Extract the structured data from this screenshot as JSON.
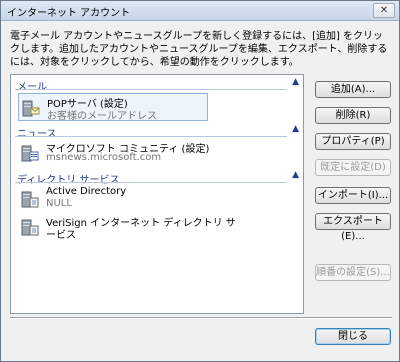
{
  "window": {
    "title": "インターネット アカウント",
    "close_glyph": "✕"
  },
  "description": "電子メール アカウントやニュースグループを新しく登録するには、[追加] をクリックします。追加したアカウントやニュースグループを編集、エクスポート、削除するには、対象をクリックしてから、希望の動作をクリックします。",
  "groups": [
    {
      "title": "メール",
      "items": [
        {
          "name": "POPサーバ (設定)",
          "sub": "お客様のメールアドレス",
          "icon": "mail-server-icon",
          "selected": true
        }
      ]
    },
    {
      "title": "ニュース",
      "items": [
        {
          "name": "マイクロソフト コミュニティ (設定)",
          "sub": "msnews.microsoft.com",
          "icon": "news-server-icon",
          "selected": false
        }
      ]
    },
    {
      "title": "ディレクトリ サービス",
      "items": [
        {
          "name": "Active Directory",
          "sub": "NULL",
          "icon": "directory-server-icon",
          "selected": false
        },
        {
          "name": "VeriSign インターネット ディレクトリ サ",
          "sub": "ービス",
          "icon": "directory-server-icon",
          "selected": false
        }
      ]
    }
  ],
  "collapse_glyph": "▲",
  "buttons": {
    "add": "追加(A)...",
    "remove": "削除(R)",
    "properties": "プロパティ(P)",
    "set_default": "既定に設定(D)",
    "import": "インポート(I)...",
    "export": "エクスポート(E)...",
    "set_order": "順番の設定(S)...",
    "close": "閉じる"
  }
}
